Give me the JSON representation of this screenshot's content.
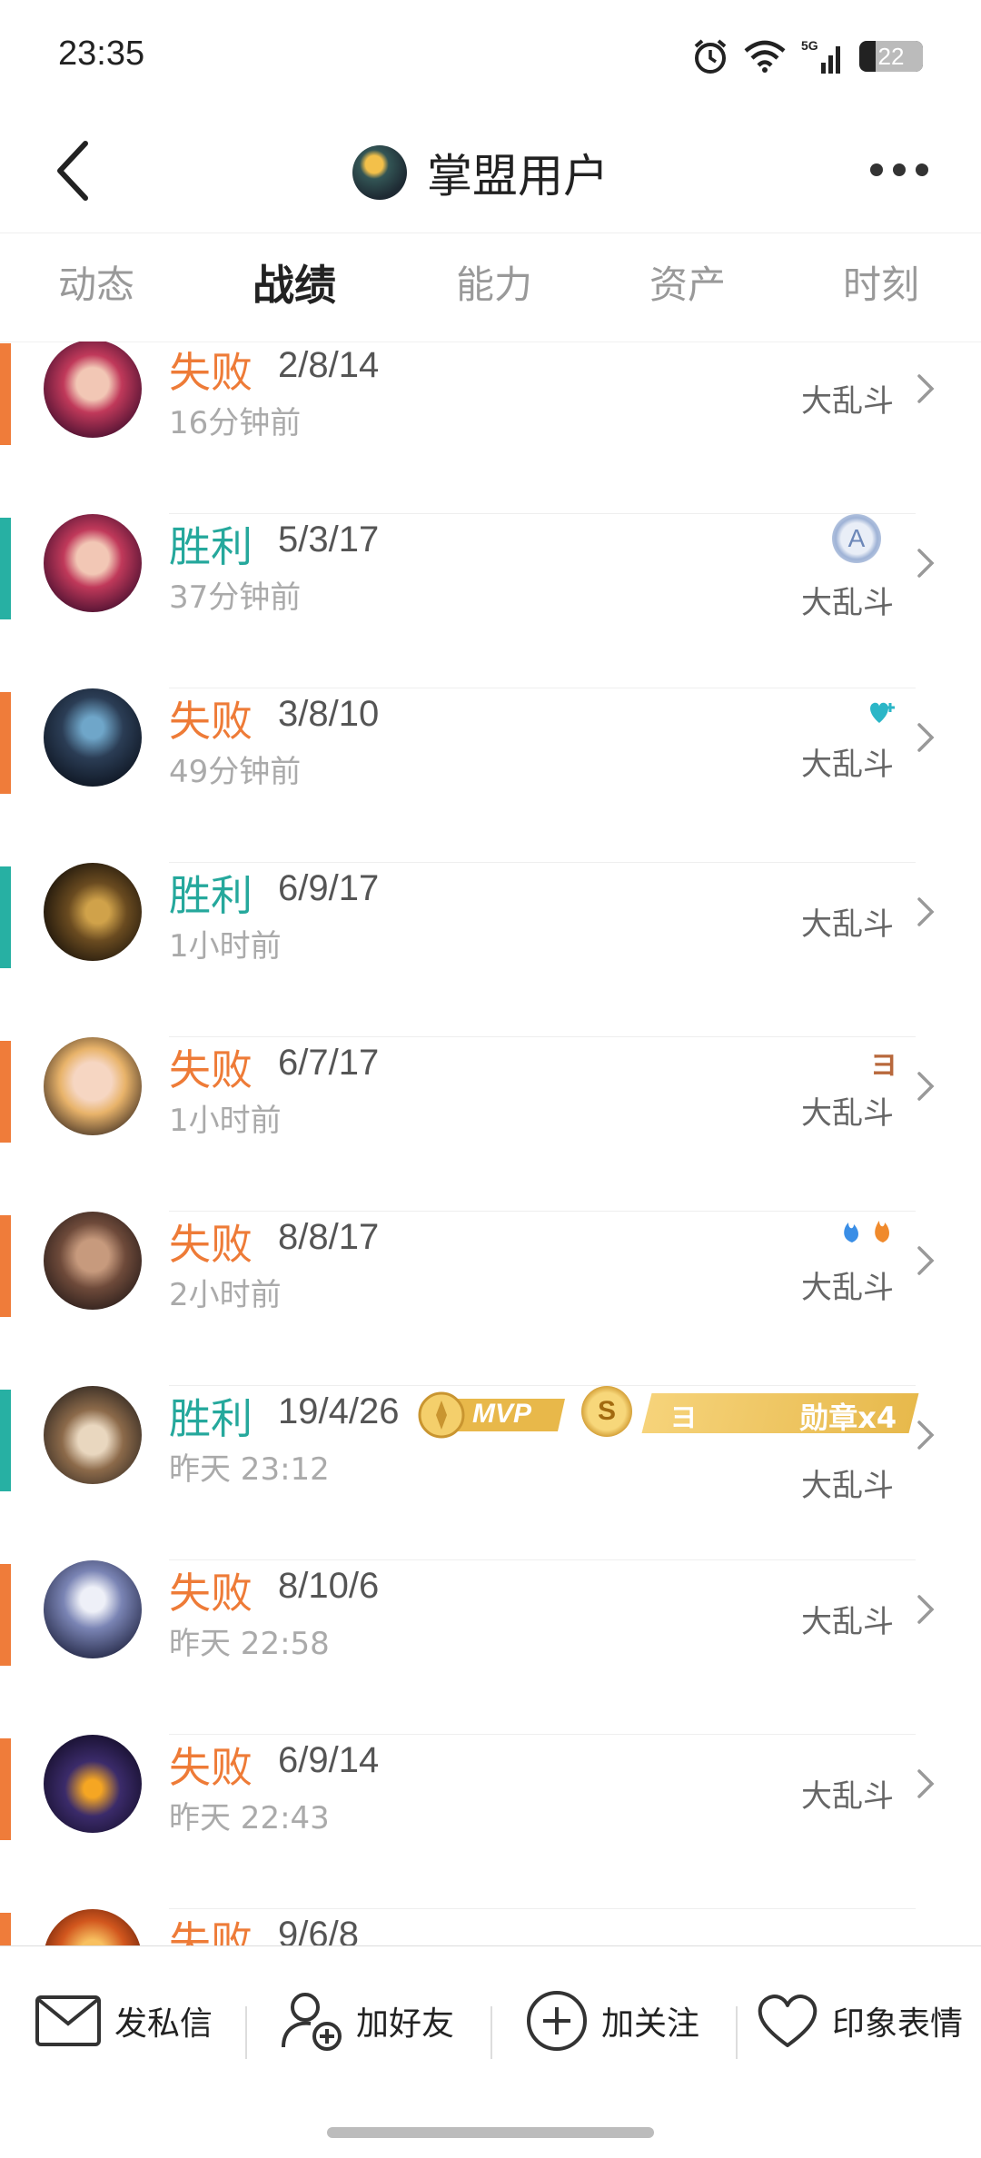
{
  "status_bar": {
    "time": "23:35",
    "battery": "22"
  },
  "header": {
    "title": "掌盟用户"
  },
  "tabs": [
    {
      "label": "动态"
    },
    {
      "label": "战绩"
    },
    {
      "label": "能力"
    },
    {
      "label": "资产"
    },
    {
      "label": "时刻"
    }
  ],
  "active_tab": "战绩",
  "matches": [
    {
      "result": "失败",
      "kda": "2/8/14",
      "time": "16分钟前",
      "mode": "大乱斗"
    },
    {
      "result": "胜利",
      "kda": "5/3/17",
      "time": "37分钟前",
      "mode": "大乱斗",
      "badge": "A"
    },
    {
      "result": "失败",
      "kda": "3/8/10",
      "time": "49分钟前",
      "mode": "大乱斗"
    },
    {
      "result": "胜利",
      "kda": "6/9/17",
      "time": "1小时前",
      "mode": "大乱斗"
    },
    {
      "result": "失败",
      "kda": "6/7/17",
      "time": "1小时前",
      "mode": "大乱斗",
      "badge": "ヨ"
    },
    {
      "result": "失败",
      "kda": "8/8/17",
      "time": "2小时前",
      "mode": "大乱斗"
    },
    {
      "result": "胜利",
      "kda": "19/4/26",
      "time": "昨天 23:12",
      "mode": "大乱斗",
      "mvp": "MVP",
      "s_badge": "S",
      "medal": "勋章x4",
      "medal_prefix": "ヨ"
    },
    {
      "result": "失败",
      "kda": "8/10/6",
      "time": "昨天 22:58",
      "mode": "大乱斗"
    },
    {
      "result": "失败",
      "kda": "6/9/14",
      "time": "昨天 22:43",
      "mode": "大乱斗"
    },
    {
      "result": "失败",
      "kda": "9/6/8",
      "time": "",
      "mode": ""
    }
  ],
  "bottom_actions": [
    {
      "label": "发私信",
      "icon": "mail-icon"
    },
    {
      "label": "加好友",
      "icon": "add-friend-icon"
    },
    {
      "label": "加关注",
      "icon": "plus-circle-icon"
    },
    {
      "label": "印象表情",
      "icon": "heart-icon"
    }
  ],
  "colors": {
    "win": "#25a89c",
    "loss": "#ee7b37",
    "mvp_gold": "#e8b84a"
  }
}
